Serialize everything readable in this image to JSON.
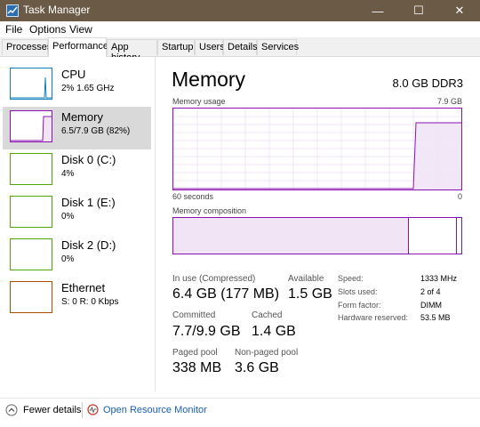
{
  "window": {
    "title": "Task Manager",
    "minimize": "—",
    "maximize": "☐",
    "close": "✕"
  },
  "menu": [
    "File",
    "Options",
    "View"
  ],
  "tabs": [
    "Processes",
    "Performance",
    "App history",
    "Startup",
    "Users",
    "Details",
    "Services"
  ],
  "active_tab": "Performance",
  "sidebar": [
    {
      "name": "CPU",
      "value": "2%  1.65 GHz",
      "color": "#117dbb",
      "selected": false
    },
    {
      "name": "Memory",
      "value": "6.5/7.9 GB (82%)",
      "color": "#8b12ae",
      "selected": true
    },
    {
      "name": "Disk 0 (C:)",
      "value": "4%",
      "color": "#4da60c",
      "selected": false
    },
    {
      "name": "Disk 1 (E:)",
      "value": "0%",
      "color": "#4da60c",
      "selected": false
    },
    {
      "name": "Disk 2 (D:)",
      "value": "0%",
      "color": "#4da60c",
      "selected": false
    },
    {
      "name": "Ethernet",
      "value": "S: 0  R: 0 Kbps",
      "color": "#a74f01",
      "selected": false
    }
  ],
  "main": {
    "title": "Memory",
    "model": "8.0 GB DDR3",
    "usage_label": "Memory usage",
    "usage_max": "7.9 GB",
    "axis_left": "60 seconds",
    "axis_right": "0",
    "composition_label": "Memory composition",
    "usage_level_percent": 82,
    "stats": {
      "in_use_label": "In use (Compressed)",
      "in_use_value": "6.4 GB (177 MB)",
      "available_label": "Available",
      "available_value": "1.5 GB",
      "committed_label": "Committed",
      "committed_value": "7.7/9.9 GB",
      "cached_label": "Cached",
      "cached_value": "1.4 GB",
      "paged_label": "Paged pool",
      "paged_value": "338 MB",
      "nonpaged_label": "Non-paged pool",
      "nonpaged_value": "3.6 GB"
    },
    "specs": {
      "speed_label": "Speed:",
      "speed_value": "1333 MHz",
      "slots_label": "Slots used:",
      "slots_value": "2 of 4",
      "form_label": "Form factor:",
      "form_value": "DIMM",
      "hw_label": "Hardware reserved:",
      "hw_value": "53.5 MB"
    }
  },
  "footer": {
    "fewer_details": "Fewer details",
    "open_monitor": "Open Resource Monitor"
  },
  "colors": {
    "memory": "#8b12ae",
    "titlebar": "#6b5a45",
    "link": "#1a5fb4"
  }
}
